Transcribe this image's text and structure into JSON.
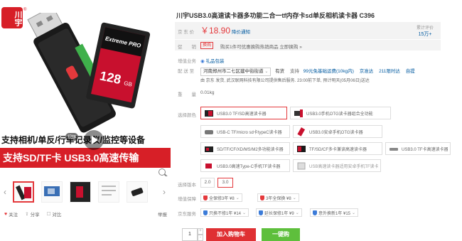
{
  "gallery": {
    "logo_text": "川宇",
    "logo_reg": "®",
    "card_brand": "Extreme PRO",
    "card_capacity": "128",
    "card_unit": "GB",
    "slogan_1": "支持相机/单反/行车记录仪/监控等设备",
    "slogan_2": "支持SD/TF卡 USB3.0高速传输",
    "video_badge": "视频",
    "thumb_prev": "‹",
    "thumb_next": "›",
    "share": {
      "follow": "关注",
      "share": "分享",
      "compare": "对比"
    },
    "report": "举报"
  },
  "product": {
    "title": "川宇USB3.0高速读卡器多功能二合一tf内存卡sd单反相机读卡器 C396",
    "price_label": "京 东 价",
    "price": "￥18.90",
    "price_notice": "降价通知",
    "comments_label": "累计评价",
    "comments_value": "15万+",
    "promo_label": "促　　销",
    "promo_tag": "换购",
    "promo_text": "购买1件可优惠换购热销商品 立即换购 »",
    "gift_label": "增值业务",
    "gift_value": "礼品包装",
    "delivery_label": "配 送 至",
    "delivery_address": "河南郑州市二七区建中街街道",
    "delivery_stock": "有货",
    "delivery_support": "支持",
    "delivery_opts": [
      "99元免基础运费(10kg内)",
      "京准达",
      "211限时达",
      "自提"
    ],
    "delivery_note": "由 京东 发货, 武汉联网科技有限公司提供售后服务. 23:00前下单, 预计明天(05月06日)送达",
    "weight_label": "重　　量",
    "weight_value": "0.01kg"
  },
  "options": {
    "color_label": "选择颜色",
    "colors": [
      "USB3.0 TF/SD高速读卡器",
      "USB3.0手机OTG读卡器组合全功能",
      "USB-C TF/micro sd卡typeC读卡器",
      "USB3.0安卓手机OTG读卡器",
      "SD/TF/CF/XD/MS/M2多功能读卡器",
      "TF/SD/CF多卡兼读高速读卡器",
      "USB3.0 TF卡高速读卡器",
      "USB3.0高速Type-C手机TF读卡器",
      "USB高速读卡器适用安卓手机TF读卡器"
    ],
    "version_label": "选择版本",
    "versions": [
      "2.0",
      "3.0"
    ],
    "warranty_label": "增值保障",
    "warranty": [
      "全保修3年 ¥8",
      "3年全保换 ¥8"
    ],
    "jd_service_label": "京东服务",
    "jd_service": [
      "只换不修1年 ¥14",
      "延长保修1年 ¥9",
      "意外换新1年 ¥15"
    ],
    "qty": "1",
    "qty_plus": "+",
    "qty_minus": "-",
    "add_cart": "加入购物车",
    "buy_now": "一键购"
  },
  "colors": {
    "accent": "#e4393c",
    "cart": "#df3033",
    "buy": "#5ebf3c",
    "link": "#005aa0"
  }
}
